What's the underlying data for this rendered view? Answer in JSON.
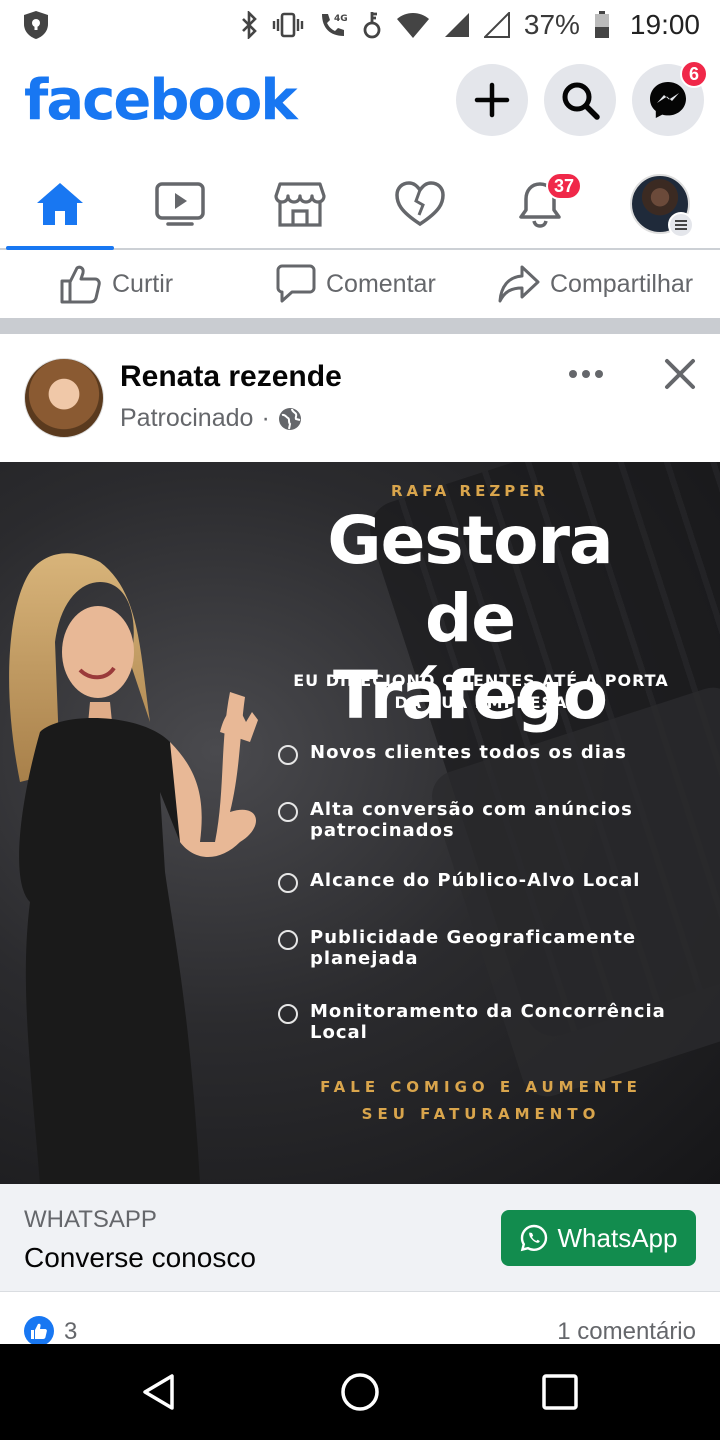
{
  "status_bar": {
    "battery": "37%",
    "time": "19:00",
    "network": "4G"
  },
  "header": {
    "logo": "facebook",
    "messenger_badge": "6",
    "brand_color": "#1877f2"
  },
  "tabs": [
    {
      "name": "home",
      "icon": "home-icon",
      "active": true
    },
    {
      "name": "watch",
      "icon": "video-icon"
    },
    {
      "name": "marketplace",
      "icon": "store-icon"
    },
    {
      "name": "dating",
      "icon": "heart-icon"
    },
    {
      "name": "notifications",
      "icon": "bell-icon",
      "badge": "37"
    },
    {
      "name": "menu",
      "icon": "profile-avatar"
    }
  ],
  "action_row": {
    "like": "Curtir",
    "comment": "Comentar",
    "share": "Compartilhar"
  },
  "post": {
    "author": "Renata rezende",
    "sponsored": "Patrocinado",
    "separator": "·"
  },
  "ad": {
    "brand": "RAFA REZPER",
    "title_line1": "Gestora",
    "title_line2": "de Tráfego",
    "subtitle": "EU DIRECIONO CLIENTES ATÉ A PORTA DA SUA EMPRESA",
    "items": [
      "Novos clientes todos os dias",
      "Alta conversão com anúncios patrocinados",
      "Alcance do Público-Alvo Local",
      "Publicidade Geograficamente planejada",
      "Monitoramento da Concorrência Local"
    ],
    "cta": "FALE COMIGO E AUMENTE SEU FATURAMENTO"
  },
  "cta_bar": {
    "label": "WHATSAPP",
    "title": "Converse conosco",
    "button": "WhatsApp",
    "button_color": "#128c4e"
  },
  "reactions": {
    "likes": "3",
    "comments": "1 comentário"
  }
}
